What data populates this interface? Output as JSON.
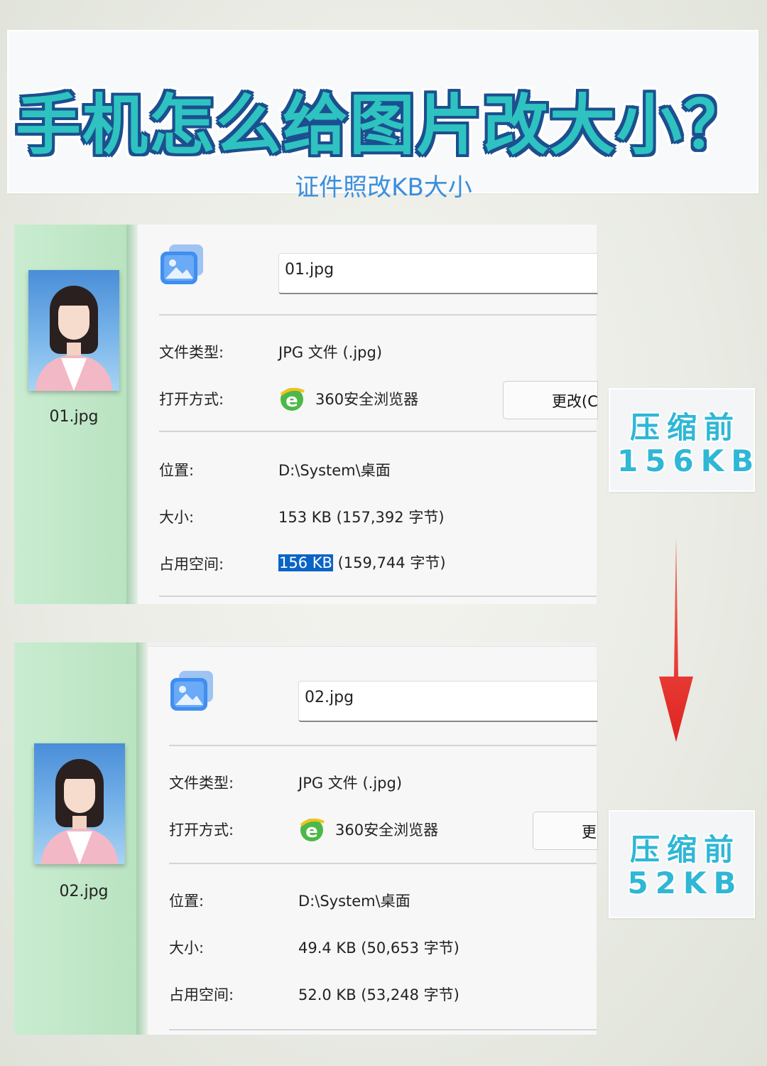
{
  "banner": {
    "title": "手机怎么给图片改大小？",
    "subtitle": "证件照改KB大小"
  },
  "panels": [
    {
      "file_label": "01.jpg",
      "file_name": "01.jpg",
      "type_label": "文件类型:",
      "type_value": "JPG 文件 (.jpg)",
      "open_label": "打开方式:",
      "open_value": "360安全浏览器",
      "change_button": "更改(C",
      "location_label": "位置:",
      "location_value": "D:\\System\\桌面",
      "size_label": "大小:",
      "size_value": "153 KB (157,392 字节)",
      "disk_label": "占用空间:",
      "disk_highlight": "156 KB",
      "disk_rest": " (159,744 字节)"
    },
    {
      "file_label": "02.jpg",
      "file_name": "02.jpg",
      "type_label": "文件类型:",
      "type_value": "JPG 文件 (.jpg)",
      "open_label": "打开方式:",
      "open_value": "360安全浏览器",
      "change_button": "更改",
      "location_label": "位置:",
      "location_value": "D:\\System\\桌面",
      "size_label": "大小:",
      "size_value": "49.4 KB (50,653 字节)",
      "disk_label": "占用空间:",
      "disk_value": "52.0 KB (53,248 字节)"
    }
  ],
  "tags": [
    {
      "line1": "压缩前",
      "line2": "156KB"
    },
    {
      "line1": "压缩前",
      "line2": "52KB"
    }
  ],
  "colors": {
    "title_fill": "#2ec3c0",
    "title_outline": "#1c4f8f",
    "subtitle": "#3b8fdc",
    "sidebar_green": "#c9ecd0",
    "highlight_blue": "#0a64c8",
    "tag_text": "#2fb7d6",
    "arrow_red": "#e0231f"
  },
  "icons": {
    "file": "image-file-icon",
    "browser": "360-browser-icon",
    "arrow": "arrow-down-icon"
  }
}
